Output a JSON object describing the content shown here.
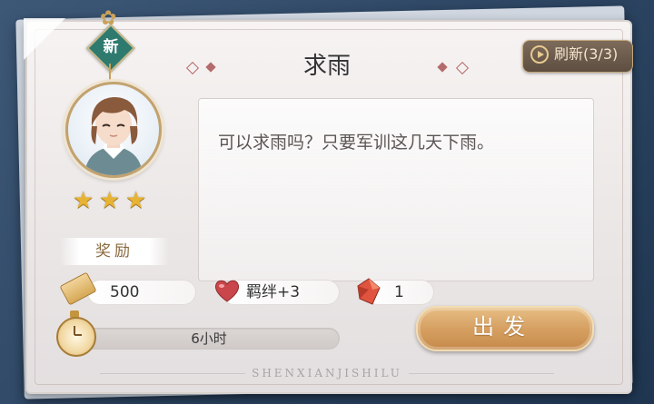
{
  "badge": {
    "new": "新"
  },
  "quest": {
    "title": "求雨",
    "description": "可以求雨吗？只要军训这几天下雨。",
    "stars": 3
  },
  "refresh": {
    "label": "刷新(3/3)"
  },
  "rewards": {
    "label": "奖励",
    "items": [
      {
        "icon": "coin-icon",
        "value": "500"
      },
      {
        "icon": "heart-icon",
        "value": "羁绊+3"
      },
      {
        "icon": "gem-icon",
        "value": "1"
      }
    ]
  },
  "duration": {
    "label": "6小时"
  },
  "depart": {
    "label": "出发"
  },
  "watermark": "SHENXIANJISHILU",
  "colors": {
    "accent_gold": "#d6a062",
    "badge_green": "#2f7a6f",
    "star": "#e7b335"
  }
}
